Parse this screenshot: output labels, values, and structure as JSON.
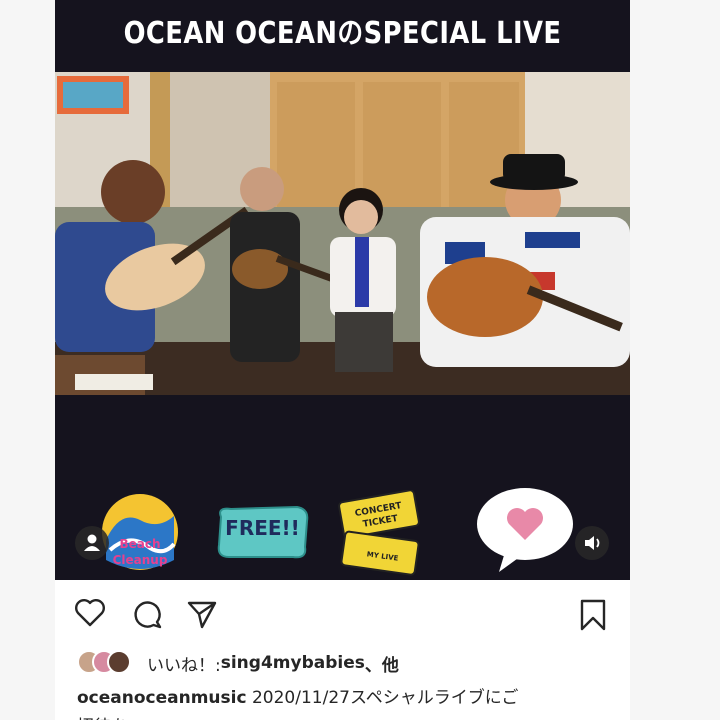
{
  "post": {
    "video_title": "OCEAN OCEANのSPECIAL LIVE",
    "stickers": {
      "beach_cleanup": "Beach Cleanup",
      "free": "FREE!!",
      "concert_ticket_top": "CONCERT",
      "concert_ticket_bottom": "TICKET",
      "ticket_sub": "MY LIVE"
    },
    "likes": {
      "prefix": "いいね！: ",
      "user": "sing4mybabies",
      "suffix": "、他"
    },
    "caption": {
      "username": "oceanoceanmusic",
      "text": "2020/11/27スペシャルライブにご",
      "continued": "招待を…"
    }
  },
  "colors": {
    "media_bg": "#15131e",
    "heart_sticker": "#e889a8",
    "free_sticker": "#5ec7c4",
    "ticket_sticker": "#f1d536"
  },
  "icons": [
    "heart-icon",
    "comment-icon",
    "share-icon",
    "bookmark-icon",
    "user-icon",
    "volume-icon"
  ]
}
